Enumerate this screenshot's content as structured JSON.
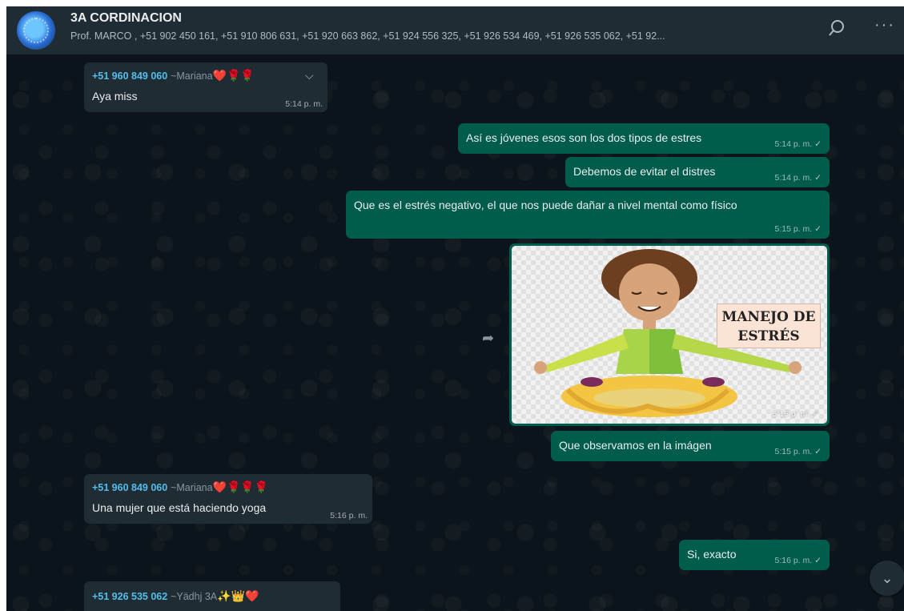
{
  "header": {
    "title": "3A CORDINACION",
    "participants": "Prof. MARCO , +51 902 450 161, +51 910 806 631, +51 920 663 862, +51 924 556 325, +51 926 534 469, +51 926 535 062, +51 92..."
  },
  "icons": {
    "search": "search-icon",
    "menu": "more-options-icon",
    "forward": "forward-icon",
    "scroll_down": "chevron-down-icon"
  },
  "colors": {
    "background": "#0b141a",
    "header": "#202c33",
    "incoming_bubble": "#202c33",
    "outgoing_bubble": "#005c4b",
    "sender_name": "#53bdeb"
  },
  "messages": [
    {
      "type": "in",
      "sender": "+51 960 849 060",
      "nick": "~Mariana",
      "emojis": "❤️🌹🌹",
      "text": "Aya miss",
      "time": "5:14 p. m."
    },
    {
      "type": "out",
      "text": "Así es jóvenes esos son los dos tipos de estres",
      "time": "5:14 p. m.",
      "tick": "✓"
    },
    {
      "type": "out",
      "text": "Debemos de evitar el distres",
      "time": "5:14 p. m.",
      "tick": "✓"
    },
    {
      "type": "out",
      "text": "Que es el estrés negativo, el que nos puede dañar a nivel mental como físico",
      "time": "5:15 p. m.",
      "tick": "✓"
    },
    {
      "type": "out-image",
      "image_text_line1": "MANEJO DE",
      "image_text_line2": "ESTRÉS",
      "time": "5:15 p. m.",
      "tick": "✓"
    },
    {
      "type": "out",
      "text": "Que observamos en la imágen",
      "time": "5:15 p. m.",
      "tick": "✓"
    },
    {
      "type": "in",
      "sender": "+51 960 849 060",
      "nick": "~Mariana",
      "emojis": "❤️🌹🌹🌹",
      "text": "Una mujer que está haciendo yoga",
      "time": "5:16 p. m."
    },
    {
      "type": "out",
      "text": "Si, exacto",
      "time": "5:16 p. m.",
      "tick": "✓"
    },
    {
      "type": "in",
      "sender": "+51 926 535 062",
      "nick": "~Yädhj 3A",
      "emojis": "✨👑❤️"
    }
  ]
}
